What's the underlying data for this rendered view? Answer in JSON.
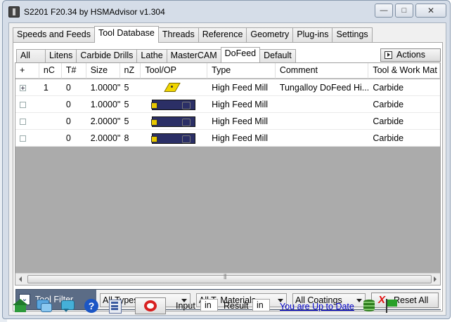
{
  "window": {
    "title": "S2201 F20.34 by HSMAdvisor v1.304",
    "min_symbol": "—",
    "max_symbol": "□",
    "close_symbol": "✕"
  },
  "main_tabs": [
    {
      "label": "Speeds and Feeds",
      "active": false
    },
    {
      "label": "Tool Database",
      "active": true
    },
    {
      "label": "Threads",
      "active": false
    },
    {
      "label": "Reference",
      "active": false
    },
    {
      "label": "Geometry",
      "active": false
    },
    {
      "label": "Plug-ins",
      "active": false
    },
    {
      "label": "Settings",
      "active": false
    }
  ],
  "sub_tabs": [
    {
      "label": "All",
      "active": false
    },
    {
      "label": "Litens",
      "active": false
    },
    {
      "label": "Carbide Drills",
      "active": false
    },
    {
      "label": "Lathe",
      "active": false
    },
    {
      "label": "MasterCAM",
      "active": false
    },
    {
      "label": "DoFeed",
      "active": true
    },
    {
      "label": "Default",
      "active": false
    }
  ],
  "actions_button": "Actions",
  "grid": {
    "columns": [
      "+",
      "nC",
      "T#",
      "Size",
      "nZ",
      "Tool/OP",
      "Type",
      "Comment",
      "Tool & Work Mat"
    ],
    "rows": [
      {
        "expander": "plus-box-icon",
        "nc": "1",
        "t": "0",
        "size": "1.0000\"",
        "nz": "5",
        "tool_icon": "insert-icon",
        "type": "High Feed Mill",
        "comment": "Tungalloy DoFeed Hi...",
        "material": "Carbide"
      },
      {
        "expander": "empty-box-icon",
        "nc": "",
        "t": "0",
        "size": "1.0000\"",
        "nz": "5",
        "tool_icon": "mill-icon",
        "type": "High Feed Mill",
        "comment": "",
        "material": "Carbide"
      },
      {
        "expander": "empty-box-icon",
        "nc": "",
        "t": "0",
        "size": "2.0000\"",
        "nz": "5",
        "tool_icon": "mill-icon",
        "type": "High Feed Mill",
        "comment": "",
        "material": "Carbide"
      },
      {
        "expander": "empty-box-icon",
        "nc": "",
        "t": "0",
        "size": "2.0000\"",
        "nz": "8",
        "tool_icon": "mill-icon",
        "type": "High Feed Mill",
        "comment": "",
        "material": "Carbide"
      }
    ]
  },
  "filter": {
    "toggle_symbol": "⌄",
    "label": "Tool Filter",
    "types": "All Types",
    "materials": "All T. Materials",
    "coatings": "All Coatings",
    "reset_label": "Reset All",
    "reset_symbol": "X"
  },
  "bottom": {
    "help_symbol": "?",
    "input_label": "Input",
    "input_unit": "in",
    "result_label": "Result",
    "result_unit": "in",
    "update_link": "You are Up to Date"
  },
  "colors": {
    "filter_bar": "#5b6c86",
    "grid_empty": "#ababab",
    "link": "#0000cc",
    "reset_x": "#e01010"
  }
}
